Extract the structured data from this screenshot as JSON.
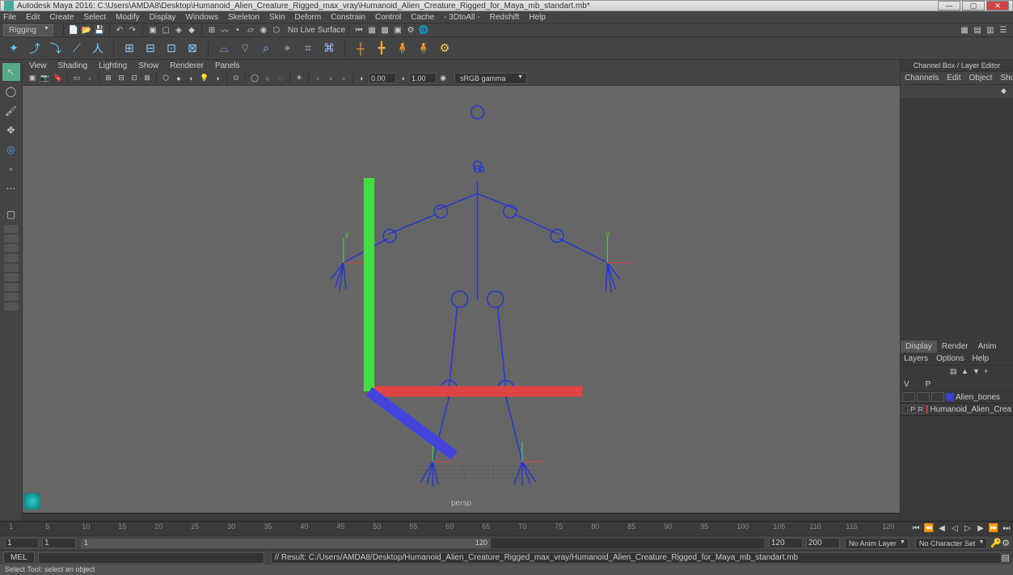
{
  "title": "Autodesk Maya 2016: C:\\Users\\AMDA8\\Desktop\\Humanoid_Alien_Creature_Rigged_max_vray\\Humanoid_Alien_Creature_Rigged_for_Maya_mb_standart.mb*",
  "menus": [
    "File",
    "Edit",
    "Create",
    "Select",
    "Modify",
    "Display",
    "Windows",
    "Skeleton",
    "Skin",
    "Deform",
    "Constrain",
    "Control",
    "Cache",
    "- 3DtoAll -",
    "Redshift",
    "Help"
  ],
  "workspace": "Rigging",
  "nolivsurface": "No Live Surface",
  "viewmenus": [
    "View",
    "Shading",
    "Lighting",
    "Show",
    "Renderer",
    "Panels"
  ],
  "viewbar": {
    "val1": "0.00",
    "val2": "1.00",
    "colorspace": "sRGB gamma"
  },
  "persp": "persp",
  "channelbox": {
    "title": "Channel Box / Layer Editor",
    "tabs": [
      "Channels",
      "Edit",
      "Object",
      "Show"
    ],
    "tabs2": [
      "Display",
      "Render",
      "Anim"
    ],
    "sub": [
      "Layers",
      "Options",
      "Help"
    ],
    "headers": [
      "V",
      "P"
    ],
    "layers": [
      {
        "v": "",
        "p": "",
        "r": "",
        "color": "#3344cc",
        "name": "Alien_bones"
      },
      {
        "v": "",
        "p": "P",
        "r": "R",
        "color": "#cc3333",
        "name": "Humanoid_Alien_Crea"
      }
    ]
  },
  "timeline": {
    "ticks": [
      1,
      5,
      10,
      15,
      20,
      25,
      30,
      35,
      40,
      45,
      50,
      55,
      60,
      65,
      70,
      75,
      80,
      85,
      90,
      95,
      100,
      105,
      110,
      115,
      120
    ],
    "current": 1
  },
  "range": {
    "start": "1",
    "startRange": "1",
    "endVis": "120",
    "end": "120",
    "endRange": "200",
    "animlayer": "No Anim Layer",
    "charset": "No Character Set"
  },
  "cmd": {
    "lang": "MEL",
    "result": "// Result: C:/Users/AMDA8/Desktop/Humanoid_Alien_Creature_Rigged_max_vray/Humanoid_Alien_Creature_Rigged_for_Maya_mb_standart.mb"
  },
  "status": "Select Tool: select an object"
}
